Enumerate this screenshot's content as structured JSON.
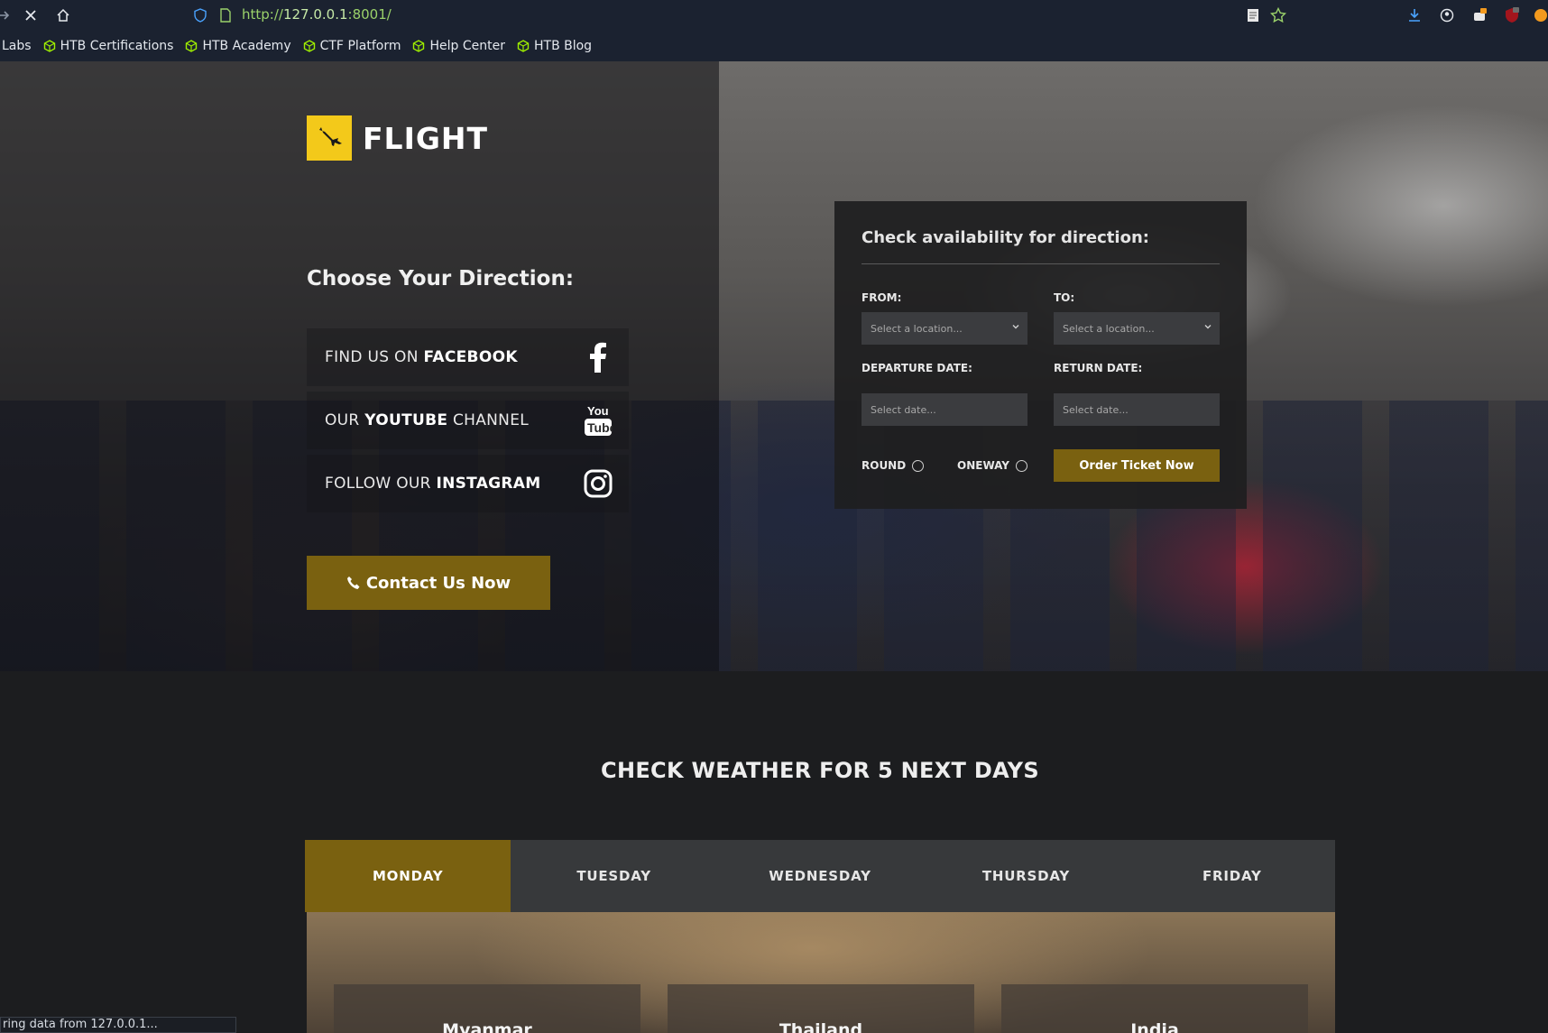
{
  "browser": {
    "url_scheme": "http://",
    "url_host": "127.0.0.1",
    "url_rest": ":8001/",
    "bookmarks": [
      "Labs",
      "HTB Certifications",
      "HTB Academy",
      "CTF Platform",
      "Help Center",
      "HTB Blog"
    ],
    "status_text": "ring data from 127.0.0.1..."
  },
  "hero": {
    "logo_text": "FLIGHT",
    "choose_heading": "Choose Your Direction:",
    "social": [
      {
        "prefix": "FIND US ON ",
        "bold": "FACEBOOK",
        "suffix": "",
        "icon": "facebook-icon"
      },
      {
        "prefix": "OUR ",
        "bold": "YOUTUBE",
        "suffix": " CHANNEL",
        "icon": "youtube-icon"
      },
      {
        "prefix": "FOLLOW OUR ",
        "bold": "INSTAGRAM",
        "suffix": "",
        "icon": "instagram-icon"
      }
    ],
    "contact_button": "Contact Us Now"
  },
  "booking": {
    "title": "Check availability for direction:",
    "from_label": "FROM:",
    "to_label": "TO:",
    "from_placeholder": "Select a location...",
    "to_placeholder": "Select a location...",
    "departure_label": "DEPARTURE DATE:",
    "return_label": "RETURN DATE:",
    "departure_placeholder": "Select date...",
    "return_placeholder": "Select date...",
    "round_label": "ROUND",
    "oneway_label": "ONEWAY",
    "order_button": "Order Ticket Now"
  },
  "weather": {
    "title": "CHECK WEATHER FOR 5 NEXT DAYS",
    "tabs": [
      "MONDAY",
      "TUESDAY",
      "WEDNESDAY",
      "THURSDAY",
      "FRIDAY"
    ],
    "active_tab": "MONDAY",
    "cities": [
      "Myanmar",
      "Thailand",
      "India"
    ]
  },
  "colors": {
    "accent": "#7a6110",
    "logo_yellow": "#f3c91a",
    "chrome_bg": "#1b2230",
    "page_bg": "#1c1d1f"
  }
}
